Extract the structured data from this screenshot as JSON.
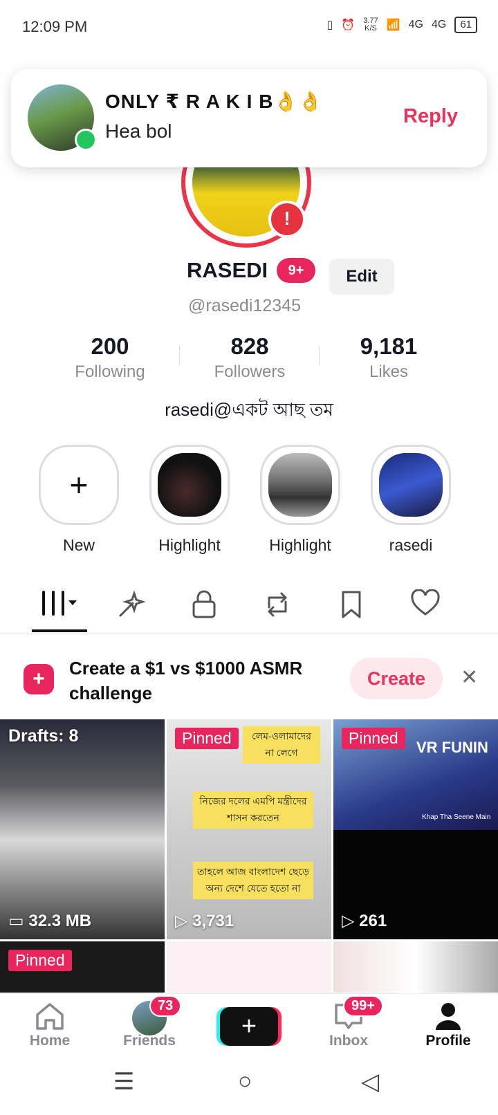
{
  "status_bar": {
    "time": "12:09 PM",
    "speed_top": "3.77",
    "speed_unit": "K/S",
    "net1": "4G",
    "net2": "4G",
    "battery": "61"
  },
  "notification": {
    "sender": "ONLY ₹ R A K I B👌👌",
    "message": "Hea bol",
    "reply_label": "Reply"
  },
  "profile": {
    "display_name": "RASEDI",
    "name_badge": "9+",
    "edit_label": "Edit",
    "handle": "@rasedi12345",
    "stats": [
      {
        "value": "200",
        "label": "Following"
      },
      {
        "value": "828",
        "label": "Followers"
      },
      {
        "value": "9,181",
        "label": "Likes"
      }
    ],
    "bio": "rasedi@একট আছ তম"
  },
  "highlights": [
    {
      "label": "New"
    },
    {
      "label": "Highlight"
    },
    {
      "label": "Highlight"
    },
    {
      "label": "rasedi"
    }
  ],
  "tabs": [
    {
      "name": "videos",
      "icon": "grid-icon"
    },
    {
      "name": "effects",
      "icon": "sparkle-icon"
    },
    {
      "name": "private",
      "icon": "lock-icon"
    },
    {
      "name": "reposts",
      "icon": "repost-icon"
    },
    {
      "name": "favorites",
      "icon": "bookmark-icon"
    },
    {
      "name": "liked",
      "icon": "heart-icon"
    }
  ],
  "banner": {
    "text": "Create a $1 vs $1000 ASMR challenge",
    "button": "Create"
  },
  "grid": {
    "drafts_label": "Drafts: 8",
    "drafts_size": "32.3 MB",
    "pinned_label": "Pinned",
    "video2_views": "3,731",
    "video3_views": "261",
    "video2_captions": [
      "লেম-ওলামাদের",
      "না লেগে",
      "নিজের দলের এমপি মন্ত্রীদের",
      "শাসন করতেন",
      "তাহলে আজ বাংলাদেশ ছেড়ে",
      "অন্য দেশে যেতে হতো না"
    ],
    "video3_sign": "VR FUNIN",
    "video3_sub": "Khap Tha Seene Main"
  },
  "bottom_nav": {
    "home": "Home",
    "friends": "Friends",
    "friends_badge": "73",
    "inbox": "Inbox",
    "inbox_badge": "99+",
    "profile": "Profile"
  },
  "colors": {
    "accent": "#e8255d",
    "reply": "#e8335c",
    "online": "#22c55e"
  }
}
